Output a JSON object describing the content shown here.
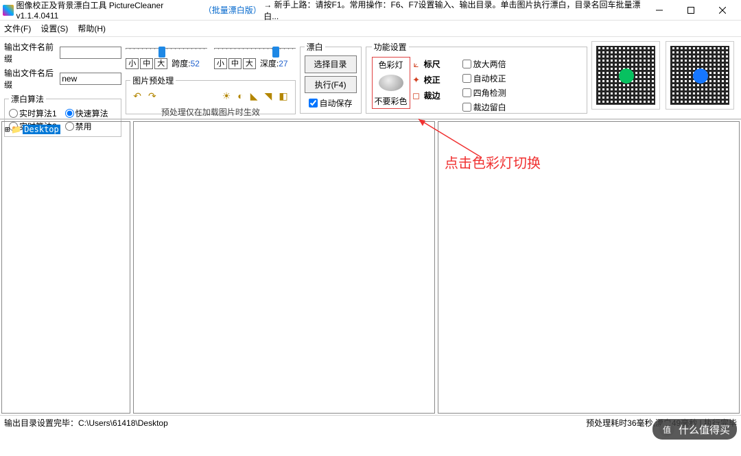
{
  "title": {
    "primary": "图像校正及背景漂白工具 PictureCleaner v1.1.4.0411",
    "secondary": "（批量漂白版）",
    "arrow": "→",
    "hint": "新手上路：请按F1。常用操作：F6、F7设置输入、输出目录。单击图片执行漂白，目录名回车批量漂白..."
  },
  "menu": {
    "file": "文件(F)",
    "settings": "设置(S)",
    "help": "帮助(H)"
  },
  "output": {
    "prefix_label": "输出文件名前缀",
    "prefix_value": "",
    "suffix_label": "输出文件名后缀",
    "suffix_value": "new"
  },
  "algo": {
    "legend": "漂白算法",
    "rt1": "实时算法1",
    "fast": "快速算法",
    "rt2": "实时算法2",
    "disable": "禁用",
    "selected": "fast"
  },
  "sliders": {
    "span": {
      "small": "小",
      "mid": "中",
      "big": "大",
      "label": "跨度:",
      "value": "52",
      "thumb_pct": 40
    },
    "depth": {
      "small": "小",
      "mid": "中",
      "big": "大",
      "label": "深度:",
      "value": "27",
      "thumb_pct": 72
    }
  },
  "preproc": {
    "legend": "图片预处理",
    "hint": "预处理仅在加载图片时生效"
  },
  "bleach": {
    "legend": "漂白",
    "select_dir": "选择目录",
    "execute": "执行(F4)",
    "autosave": "自动保存"
  },
  "func": {
    "legend": "功能设置",
    "color_lamp_title": "色彩灯",
    "color_lamp_note": "不要彩色",
    "ruler": "标尺",
    "correct": "校正",
    "crop": "裁边",
    "zoom2x": "放大两倍",
    "auto_correct": "自动校正",
    "corner_detect": "四角检测",
    "crop_margin": "裁边留白"
  },
  "tree": {
    "root": "Desktop"
  },
  "status": {
    "left_label": "输出目录设置完毕：",
    "left_path": "C:\\Users\\61418\\Desktop",
    "right": "预处理耗时36毫秒,漂白49毫秒 | 执行完毕"
  },
  "annotation": "点击色彩灯切换",
  "watermark": {
    "icon": "值",
    "text": "什么值得买"
  }
}
